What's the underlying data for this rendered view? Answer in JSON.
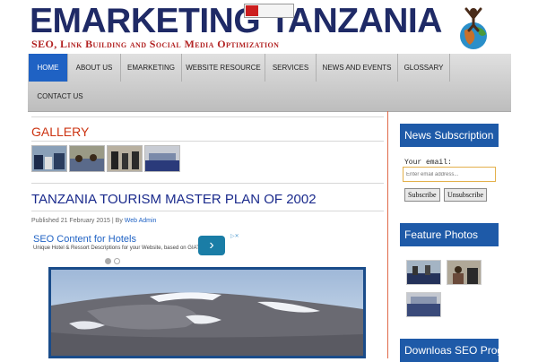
{
  "header": {
    "site_title": "EMARKETING TANZANIA",
    "tagline": "SEO, Link Building and Social Media Optimization"
  },
  "nav": {
    "items": [
      {
        "label": "Home"
      },
      {
        "label": "About Us"
      },
      {
        "label": "Emarketing"
      },
      {
        "label": "Website Resource"
      },
      {
        "label": "Services"
      },
      {
        "label": "News and Events"
      },
      {
        "label": "Glossary"
      },
      {
        "label": "Contact Us"
      }
    ],
    "active_index": 0
  },
  "gallery": {
    "title": "GALLERY",
    "thumbnail_count": 4
  },
  "article": {
    "title": "TANZANIA TOURISM MASTER PLAN OF 2002",
    "published": "Published 21 February 2015 | By ",
    "author": "Web Admin"
  },
  "ad": {
    "title": "SEO Content for Hotels",
    "text": "Unique Hotel & Ressort Descriptions for your Website, based on GIATA",
    "arrow": "›",
    "close": "▷✕"
  },
  "sidebar": {
    "news": {
      "heading": "News Subscription",
      "email_label": "Your email:",
      "email_placeholder": "Enter email address...",
      "subscribe_label": "Subscribe",
      "unsubscribe_label": "Unsubscribe"
    },
    "feature": {
      "heading": "Feature Photos"
    },
    "downloads": {
      "heading": "Downloas SEO Prog"
    }
  },
  "colors": {
    "brand_blue": "#1e5aa8",
    "title_navy": "#1f2a66",
    "accent_red": "#cc3311"
  }
}
